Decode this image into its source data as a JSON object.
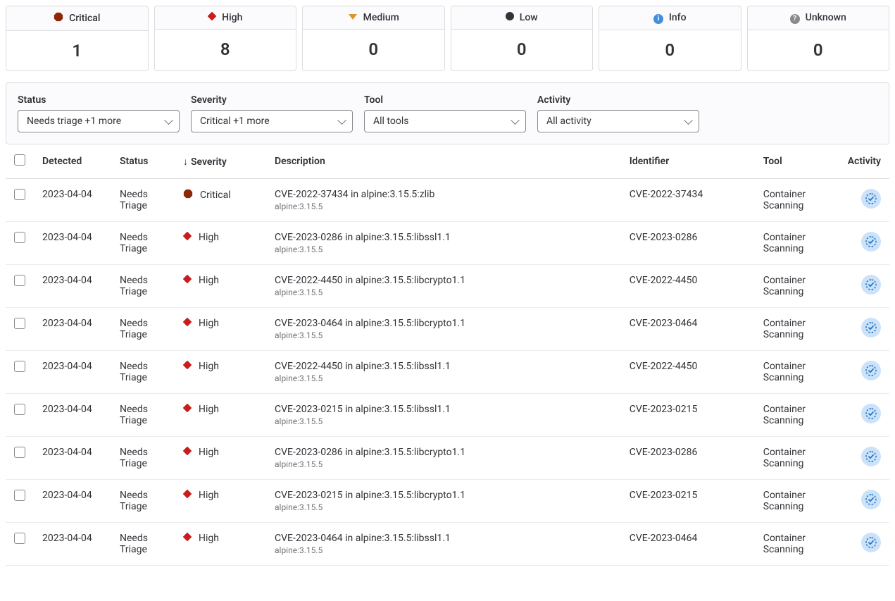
{
  "severity_cards": [
    {
      "label": "Critical",
      "count": 1,
      "icon": "critical"
    },
    {
      "label": "High",
      "count": 8,
      "icon": "high"
    },
    {
      "label": "Medium",
      "count": 0,
      "icon": "medium"
    },
    {
      "label": "Low",
      "count": 0,
      "icon": "low"
    },
    {
      "label": "Info",
      "count": 0,
      "icon": "info"
    },
    {
      "label": "Unknown",
      "count": 0,
      "icon": "unknown"
    }
  ],
  "filters": {
    "status": {
      "label": "Status",
      "value": "Needs triage +1 more"
    },
    "severity": {
      "label": "Severity",
      "value": "Critical +1 more"
    },
    "tool": {
      "label": "Tool",
      "value": "All tools"
    },
    "activity": {
      "label": "Activity",
      "value": "All activity"
    }
  },
  "columns": {
    "detected": "Detected",
    "status": "Status",
    "severity": "Severity",
    "description": "Description",
    "identifier": "Identifier",
    "tool": "Tool",
    "activity": "Activity"
  },
  "rows": [
    {
      "detected": "2023-04-04",
      "status": "Needs Triage",
      "severity": "Critical",
      "severity_icon": "critical",
      "desc": "CVE-2022-37434 in alpine:3.15.5:zlib",
      "sub": "alpine:3.15.5",
      "identifier": "CVE-2022-37434",
      "tool": "Container Scanning"
    },
    {
      "detected": "2023-04-04",
      "status": "Needs Triage",
      "severity": "High",
      "severity_icon": "high",
      "desc": "CVE-2023-0286 in alpine:3.15.5:libssl1.1",
      "sub": "alpine:3.15.5",
      "identifier": "CVE-2023-0286",
      "tool": "Container Scanning"
    },
    {
      "detected": "2023-04-04",
      "status": "Needs Triage",
      "severity": "High",
      "severity_icon": "high",
      "desc": "CVE-2022-4450 in alpine:3.15.5:libcrypto1.1",
      "sub": "alpine:3.15.5",
      "identifier": "CVE-2022-4450",
      "tool": "Container Scanning"
    },
    {
      "detected": "2023-04-04",
      "status": "Needs Triage",
      "severity": "High",
      "severity_icon": "high",
      "desc": "CVE-2023-0464 in alpine:3.15.5:libcrypto1.1",
      "sub": "alpine:3.15.5",
      "identifier": "CVE-2023-0464",
      "tool": "Container Scanning"
    },
    {
      "detected": "2023-04-04",
      "status": "Needs Triage",
      "severity": "High",
      "severity_icon": "high",
      "desc": "CVE-2022-4450 in alpine:3.15.5:libssl1.1",
      "sub": "alpine:3.15.5",
      "identifier": "CVE-2022-4450",
      "tool": "Container Scanning"
    },
    {
      "detected": "2023-04-04",
      "status": "Needs Triage",
      "severity": "High",
      "severity_icon": "high",
      "desc": "CVE-2023-0215 in alpine:3.15.5:libssl1.1",
      "sub": "alpine:3.15.5",
      "identifier": "CVE-2023-0215",
      "tool": "Container Scanning"
    },
    {
      "detected": "2023-04-04",
      "status": "Needs Triage",
      "severity": "High",
      "severity_icon": "high",
      "desc": "CVE-2023-0286 in alpine:3.15.5:libcrypto1.1",
      "sub": "alpine:3.15.5",
      "identifier": "CVE-2023-0286",
      "tool": "Container Scanning"
    },
    {
      "detected": "2023-04-04",
      "status": "Needs Triage",
      "severity": "High",
      "severity_icon": "high",
      "desc": "CVE-2023-0215 in alpine:3.15.5:libcrypto1.1",
      "sub": "alpine:3.15.5",
      "identifier": "CVE-2023-0215",
      "tool": "Container Scanning"
    },
    {
      "detected": "2023-04-04",
      "status": "Needs Triage",
      "severity": "High",
      "severity_icon": "high",
      "desc": "CVE-2023-0464 in alpine:3.15.5:libssl1.1",
      "sub": "alpine:3.15.5",
      "identifier": "CVE-2023-0464",
      "tool": "Container Scanning"
    }
  ]
}
